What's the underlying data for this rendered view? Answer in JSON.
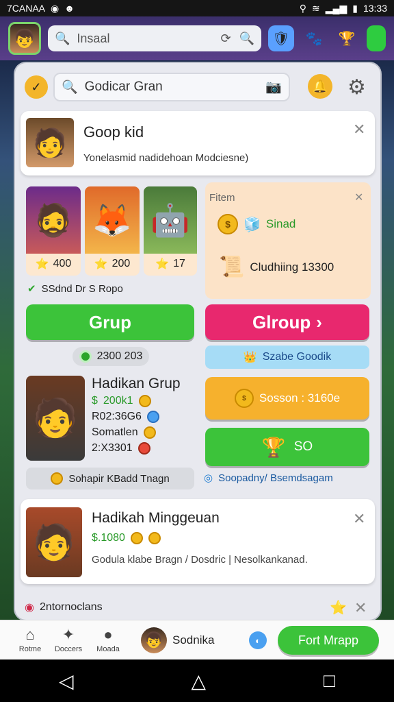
{
  "status_bar": {
    "time_left": "7CANAA",
    "time_right": "13:33"
  },
  "top_bar": {
    "search_placeholder": "Insaal"
  },
  "panel": {
    "search_value": "Godicar Gran",
    "profile_card": {
      "title": "Goop kid",
      "subtitle": "Yonelasmid nadidehoan Modciesne)"
    },
    "tiles": [
      {
        "count": "400"
      },
      {
        "count": "200"
      },
      {
        "count": "17"
      }
    ],
    "verified_text": "SSdnd Dr S Ropo",
    "filter_card": {
      "title": "Fitem",
      "item1": "Sinad",
      "item2": "Cludhiing 13300"
    },
    "grup_button": "Grup",
    "group_button": "Glroup",
    "balance_pill": "2300 203",
    "score_pill": "Szabe Goodik",
    "member_card": {
      "name": "Hadikan Grup",
      "stats": [
        "200k1",
        "R02:36G6",
        "Somatlen",
        "2:X3301"
      ],
      "footer": "Sohapir KBadd Tnagn"
    },
    "reward_button": "Sosson : 3160e",
    "so_button": "SO",
    "link_text": "Soopadny/ Bsemdsagam",
    "second_card": {
      "name": "Hadikah Minggeuan",
      "price": "$.1080",
      "desc": "Godula klabe Bragn  /  Dosdric | Nesolkankanad."
    },
    "bottom_strip": "2ntornoclans"
  },
  "bottom_nav": {
    "items": [
      "Rotme",
      "Doccers",
      "Moada"
    ],
    "user_name": "Sodnika",
    "cta": "Fort Mrapp"
  },
  "colors": {
    "green": "#3cc33a",
    "pink": "#e8286e",
    "orange": "#f6b12d",
    "purple": "#4a3a7c"
  }
}
